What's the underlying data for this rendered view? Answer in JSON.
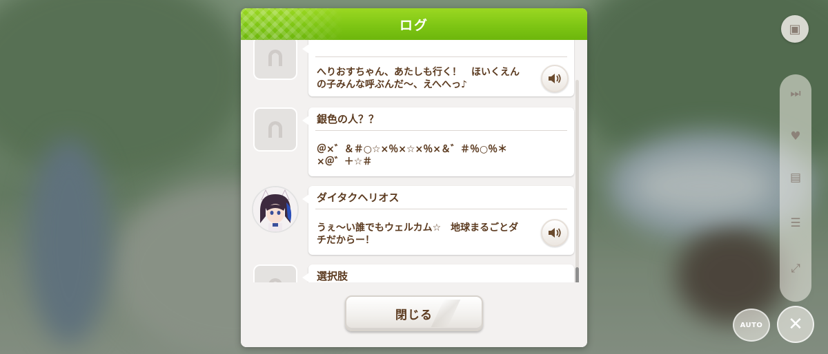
{
  "dialog": {
    "title": "ログ",
    "close_label": "閉じる"
  },
  "entries": [
    {
      "speaker": "",
      "text_lines": [
        "へりおすちゃん、あたしも行く！　ほいくえん",
        "の子みんな呼ぶんだ～、えへへっ♪"
      ],
      "has_voice": true,
      "avatar": "horseshoe-placeholder-icon"
    },
    {
      "speaker": "銀色の人？？",
      "text_lines": [
        "＠×゛＆＃○☆×％×☆×％×＆゛＃％○％＊",
        "×＠゛＋☆＃"
      ],
      "has_voice": false,
      "avatar": "horseshoe-placeholder-icon"
    },
    {
      "speaker": "ダイタクヘリオス",
      "text_lines": [
        "うぇ～い誰でもウェルカム☆　地球まるごとダ",
        "チだからー！"
      ],
      "has_voice": true,
      "avatar": "character-portrait"
    },
    {
      "speaker": "選択肢",
      "text_lines": [],
      "has_voice": false,
      "avatar": "horseshoe-placeholder-icon"
    }
  ],
  "controls": {
    "auto_label": "AUTO"
  },
  "colors": {
    "header_green": "#7cc413",
    "text_brown": "#5b3a1f",
    "panel_bg": "#f3f1f0"
  }
}
